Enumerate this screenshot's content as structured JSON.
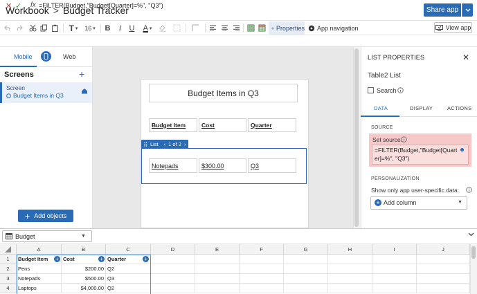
{
  "titlebar": {
    "crumb_root": "Workbook",
    "crumb_sep": ">",
    "crumb_current": "Budget Tracker",
    "share_label": "Share app",
    "share_caret": "⌄"
  },
  "toolbar": {
    "font_label": "T",
    "font_size": "16",
    "bold": "B",
    "italic": "I",
    "underline": "U",
    "text_color": "A",
    "properties_label": "Properties",
    "app_nav_label": "App navigation",
    "view_app_label": "View app"
  },
  "formula_bar": {
    "cancel": "✕",
    "confirm": "✓",
    "fx": "fx",
    "formula": "=FILTER(Budget,\"Budget[Quarter]=%\", \"Q3\")"
  },
  "left_panel": {
    "tab_mobile": "Mobile",
    "tab_web": "Web",
    "screens_title": "Screens",
    "screens_add": "+",
    "screen_name": "Screen",
    "screen_sub": "Budget Items in Q3",
    "add_objects_label": "Add objects"
  },
  "canvas": {
    "title": "Budget Items in Q3",
    "headers": [
      "Budget Item",
      "Cost",
      "Quarter"
    ],
    "list_tag": "List",
    "list_pager": "1 of 2",
    "row": [
      "Notepads",
      "$300.00",
      "Q3"
    ]
  },
  "right_panel": {
    "title": "LIST PROPERTIES",
    "close": "✕",
    "name": "Table2 List",
    "search_label": "Search",
    "tabs": [
      "DATA",
      "DISPLAY",
      "ACTIONS"
    ],
    "source_section": "SOURCE",
    "set_source_label": "Set source:",
    "formula": "=FILTER(Budget,\"Budget[Quarter]=%\", \"Q3\")",
    "personalization_section": "PERSONALIZATION",
    "show_only_label": "Show only app user-specific data:",
    "add_column_label": "Add column"
  },
  "sheet": {
    "name": "Budget",
    "columns": [
      "A",
      "B",
      "C",
      "D",
      "E",
      "F",
      "G",
      "H",
      "I",
      "J"
    ],
    "rows": [
      {
        "num": "1",
        "a": "Budget Item",
        "b": "Cost",
        "c": "Quarter"
      },
      {
        "num": "2",
        "a": "Pens",
        "b": "$200.00",
        "c": "Q2"
      },
      {
        "num": "3",
        "a": "Notepads",
        "b": "$500.00",
        "c": "Q3"
      },
      {
        "num": "4",
        "a": "Laptops",
        "b": "$4,000.00",
        "c": "Q2"
      }
    ]
  },
  "colors": {
    "accent": "#2a6bb5",
    "error_highlight": "#f7c8c8"
  }
}
